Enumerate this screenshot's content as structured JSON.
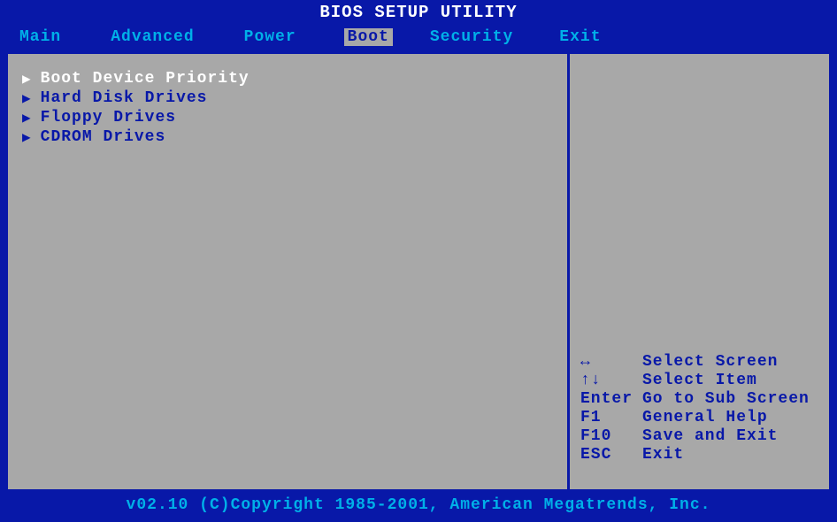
{
  "title": "BIOS SETUP UTILITY",
  "menu": {
    "items": [
      {
        "label": "Main",
        "active": false
      },
      {
        "label": "Advanced",
        "active": false
      },
      {
        "label": "Power",
        "active": false
      },
      {
        "label": "Boot",
        "active": true
      },
      {
        "label": "Security",
        "active": false
      },
      {
        "label": "Exit",
        "active": false
      }
    ]
  },
  "boot_items": [
    {
      "label": "Boot Device Priority",
      "selected": true
    },
    {
      "label": "Hard Disk Drives",
      "selected": false
    },
    {
      "label": "Floppy Drives",
      "selected": false
    },
    {
      "label": "CDROM Drives",
      "selected": false
    }
  ],
  "help": [
    {
      "key": "↔",
      "action": "Select Screen"
    },
    {
      "key": "↑↓",
      "action": "Select Item"
    },
    {
      "key": "Enter",
      "action": "Go to Sub Screen"
    },
    {
      "key": "F1",
      "action": "General Help"
    },
    {
      "key": "F10",
      "action": "Save and Exit"
    },
    {
      "key": "ESC",
      "action": "Exit"
    }
  ],
  "footer": "v02.10 (C)Copyright 1985-2001, American Megatrends, Inc."
}
